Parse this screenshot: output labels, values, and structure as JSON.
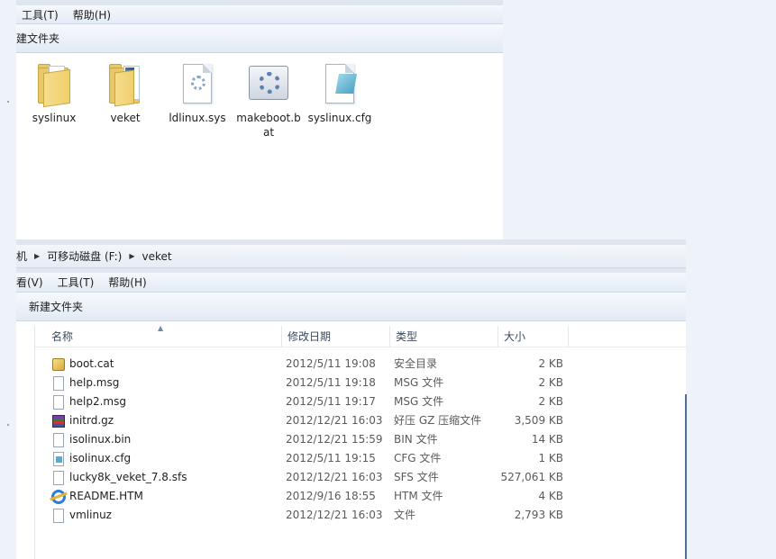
{
  "top_window": {
    "menu": [
      "工具(T)",
      "帮助(H)"
    ],
    "toolbar_button": "建文件夹",
    "items": [
      {
        "name": "syslinux",
        "kind": "folder"
      },
      {
        "name": "veket",
        "kind": "folder-book"
      },
      {
        "name": "ldlinux.sys",
        "kind": "system-file"
      },
      {
        "name": "makeboot.bat",
        "kind": "batch-file"
      },
      {
        "name": "syslinux.cfg",
        "kind": "config-file"
      }
    ]
  },
  "bottom_window": {
    "breadcrumb": [
      "机",
      "可移动磁盘 (F:)",
      "veket"
    ],
    "menu": [
      "看(V)",
      "工具(T)",
      "帮助(H)"
    ],
    "toolbar_button": "新建文件夹",
    "columns": [
      "名称",
      "修改日期",
      "类型",
      "大小"
    ],
    "files": [
      {
        "name": "boot.cat",
        "date": "2012/5/11 19:08",
        "type": "安全目录",
        "size": "2 KB",
        "icon": "catalog-icon"
      },
      {
        "name": "help.msg",
        "date": "2012/5/11 19:18",
        "type": "MSG 文件",
        "size": "2 KB",
        "icon": "file-icon"
      },
      {
        "name": "help2.msg",
        "date": "2012/5/11 19:17",
        "type": "MSG 文件",
        "size": "2 KB",
        "icon": "file-icon"
      },
      {
        "name": "initrd.gz",
        "date": "2012/12/21 16:03",
        "type": "好压 GZ 压缩文件",
        "size": "3,509 KB",
        "icon": "archive-icon"
      },
      {
        "name": "isolinux.bin",
        "date": "2012/12/21 15:59",
        "type": "BIN 文件",
        "size": "14 KB",
        "icon": "file-icon"
      },
      {
        "name": "isolinux.cfg",
        "date": "2012/5/11 19:15",
        "type": "CFG 文件",
        "size": "1 KB",
        "icon": "config-file-icon"
      },
      {
        "name": "lucky8k_veket_7.8.sfs",
        "date": "2012/12/21 16:03",
        "type": "SFS 文件",
        "size": "527,061 KB",
        "icon": "file-icon"
      },
      {
        "name": "README.HTM",
        "date": "2012/9/16 18:55",
        "type": "HTM 文件",
        "size": "4 KB",
        "icon": "ie-html-icon"
      },
      {
        "name": "vmlinuz",
        "date": "2012/12/21 16:03",
        "type": "文件",
        "size": "2,793 KB",
        "icon": "file-icon"
      }
    ]
  }
}
